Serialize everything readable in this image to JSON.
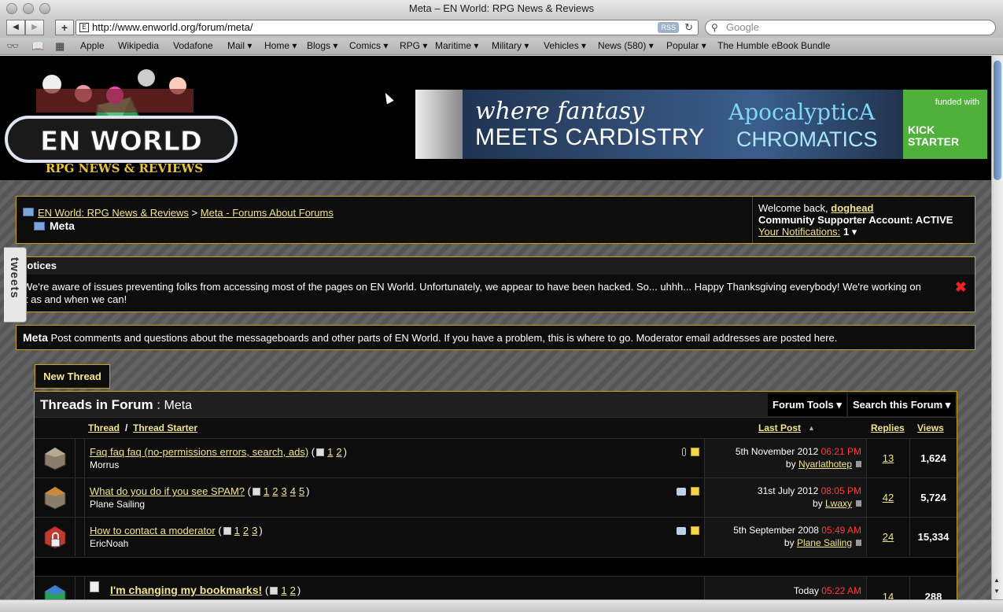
{
  "window": {
    "title": "Meta – EN World: RPG News & Reviews"
  },
  "toolbar": {
    "url": "http://www.enworld.org/forum/meta/",
    "rss_label": "RSS",
    "search_placeholder": "Google"
  },
  "bookmarks": [
    "Apple",
    "Wikipedia",
    "Vodafone",
    "Mail ▾",
    "Home ▾",
    "Blogs ▾",
    "Comics ▾",
    "RPG ▾",
    "Maritime ▾",
    "Military ▾",
    "Vehicles ▾",
    "News (580) ▾",
    "Popular ▾",
    "The Humble eBook Bundle"
  ],
  "logo": {
    "name": "EN WORLD",
    "tagline": "RPG NEWS & REVIEWS"
  },
  "banner": {
    "line1": "where fantasy",
    "line2": "MEETS CARDISTRY",
    "brand1": "ApocalypticA",
    "brand2": "CHROMATICS",
    "funded": "funded with",
    "kick": "KICK",
    "starter": "STARTER"
  },
  "breadcrumb": {
    "home": "EN World: RPG News & Reviews",
    "sep": ">",
    "parent": "Meta - Forums About Forums",
    "current": "Meta"
  },
  "welcome": {
    "greeting": "Welcome back,",
    "username": "doghead",
    "account": "Community Supporter Account: ACTIVE",
    "notifications_label": "Your Notifications:",
    "notifications_count": "1"
  },
  "notices": {
    "heading": "Notices",
    "text": "We're aware of issues preventing folks from accessing most of the pages on EN World. Unfortunately, we appear to have been hacked. So... uhhh... Happy Thanksgiving everybody! We're working on it as and when we can!"
  },
  "forum": {
    "name": "Meta",
    "description": "Post comments and questions about the messageboards and other parts of EN World. If you have a problem, this is where to go. Moderator email addresses are posted here."
  },
  "new_thread_label": "New Thread",
  "threads_header": {
    "title": "Threads in Forum",
    "sep": ":",
    "forum": "Meta",
    "tools": "Forum Tools",
    "search": "Search this Forum"
  },
  "columns": {
    "thread": "Thread",
    "slash": "/",
    "starter": "Thread Starter",
    "last_post": "Last Post",
    "replies": "Replies",
    "views": "Views"
  },
  "threads": [
    {
      "title": "Faq faq faq (no-permissions errors, search, ads)",
      "pages": [
        "1",
        "2"
      ],
      "starter": "Morrus",
      "date": "5th November 2012",
      "time": "06:21 PM",
      "by": "by",
      "last_user": "Nyarlathotep",
      "replies": "13",
      "views": "1,624"
    },
    {
      "title": "What do you do if you see SPAM?",
      "pages": [
        "1",
        "2",
        "3",
        "4",
        "5"
      ],
      "starter": "Plane Sailing",
      "date": "31st July 2012",
      "time": "08:05 PM",
      "by": "by",
      "last_user": "Lwaxy",
      "replies": "42",
      "views": "5,724"
    },
    {
      "title": "How to contact a moderator",
      "pages": [
        "1",
        "2",
        "3"
      ],
      "starter": "EricNoah",
      "date": "5th September 2008",
      "time": "05:49 AM",
      "by": "by",
      "last_user": "Plane Sailing",
      "replies": "24",
      "views": "15,334"
    },
    {
      "title": "I'm changing my bookmarks!",
      "pages": [
        "1",
        "2"
      ],
      "starter": "",
      "date": "Today",
      "time": "05:22 AM",
      "by": "",
      "last_user": "",
      "replies": "14",
      "views": "288"
    }
  ],
  "sidebar_tab": "tweets",
  "colors": {
    "gold": "#c9a21a",
    "link": "#f2e48c",
    "red_time": "#ff3b3b"
  }
}
